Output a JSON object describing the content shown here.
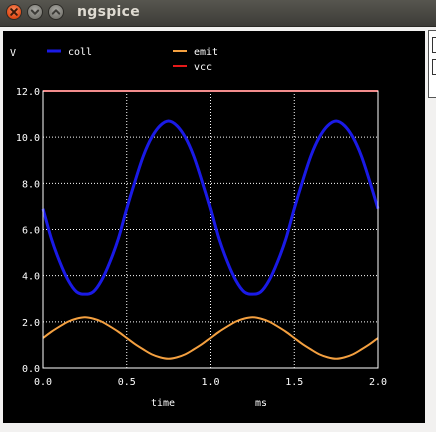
{
  "window": {
    "title": "ngspice",
    "buttons": [
      "close-icon",
      "minimize-icon",
      "maximize-icon"
    ]
  },
  "chart_data": {
    "type": "line",
    "ylabel": "V",
    "xlabel": "time",
    "xunit": "ms",
    "xlim": [
      0.0,
      2.0
    ],
    "ylim": [
      0.0,
      12.0
    ],
    "xticks": [
      "0.0",
      "0.5",
      "1.0",
      "1.5",
      "2.0"
    ],
    "yticks": [
      "0.0",
      "2.0",
      "4.0",
      "6.0",
      "8.0",
      "10.0",
      "12.0"
    ],
    "grid": true,
    "background": "#000000",
    "series": [
      {
        "name": "coll",
        "color": "#1a1ae6",
        "x": [
          0.0,
          0.05,
          0.1,
          0.15,
          0.2,
          0.25,
          0.3,
          0.35,
          0.4,
          0.45,
          0.5,
          0.55,
          0.6,
          0.65,
          0.7,
          0.75,
          0.8,
          0.85,
          0.9,
          0.95,
          1.0,
          1.05,
          1.1,
          1.15,
          1.2,
          1.25,
          1.3,
          1.35,
          1.4,
          1.45,
          1.5,
          1.55,
          1.6,
          1.65,
          1.7,
          1.75,
          1.8,
          1.85,
          1.9,
          1.95,
          2.0
        ],
        "values": [
          6.9,
          5.6,
          4.6,
          3.8,
          3.3,
          3.2,
          3.3,
          3.8,
          4.6,
          5.6,
          6.9,
          8.1,
          9.2,
          10.0,
          10.5,
          10.7,
          10.5,
          10.0,
          9.2,
          8.1,
          6.9,
          5.6,
          4.6,
          3.8,
          3.3,
          3.2,
          3.3,
          3.8,
          4.6,
          5.6,
          6.9,
          8.1,
          9.2,
          10.0,
          10.5,
          10.7,
          10.5,
          10.0,
          9.2,
          8.1,
          6.9
        ]
      },
      {
        "name": "emit",
        "color": "#f4a040",
        "x": [
          0.0,
          0.05,
          0.1,
          0.15,
          0.2,
          0.25,
          0.3,
          0.35,
          0.4,
          0.45,
          0.5,
          0.55,
          0.6,
          0.65,
          0.7,
          0.75,
          0.8,
          0.85,
          0.9,
          0.95,
          1.0,
          1.05,
          1.1,
          1.15,
          1.2,
          1.25,
          1.3,
          1.35,
          1.4,
          1.45,
          1.5,
          1.55,
          1.6,
          1.65,
          1.7,
          1.75,
          1.8,
          1.85,
          1.9,
          1.95,
          2.0
        ],
        "values": [
          1.3,
          1.57,
          1.8,
          2.01,
          2.14,
          2.2,
          2.14,
          2.01,
          1.8,
          1.57,
          1.3,
          1.03,
          0.8,
          0.59,
          0.46,
          0.4,
          0.46,
          0.59,
          0.8,
          1.03,
          1.3,
          1.57,
          1.8,
          2.01,
          2.14,
          2.2,
          2.14,
          2.01,
          1.8,
          1.57,
          1.3,
          1.03,
          0.8,
          0.59,
          0.46,
          0.4,
          0.46,
          0.59,
          0.8,
          1.03,
          1.3
        ]
      },
      {
        "name": "vcc",
        "color": "#e61a1a",
        "x": [
          0.0,
          2.0
        ],
        "values": [
          12.0,
          12.0
        ]
      }
    ]
  }
}
